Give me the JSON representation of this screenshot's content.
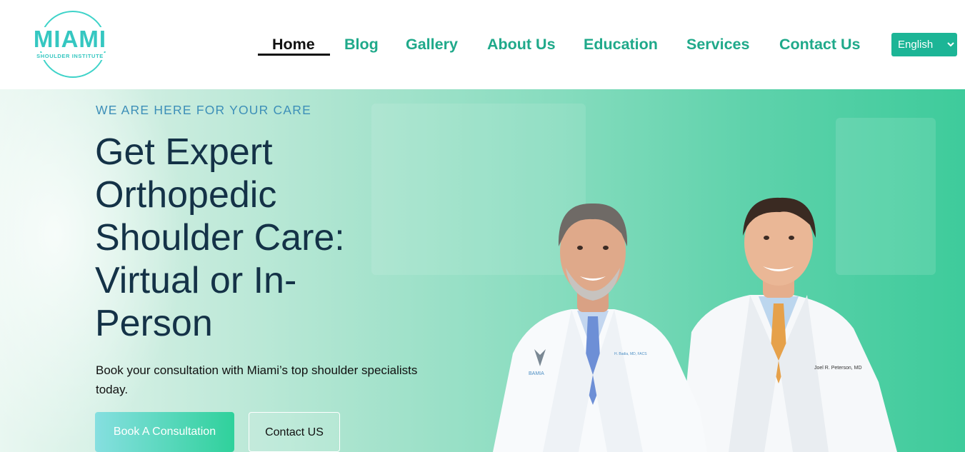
{
  "header": {
    "logo": {
      "word": "MIAMI",
      "sub": "SHOULDER INSTITUTE"
    },
    "nav": [
      {
        "label": "Home",
        "active": true
      },
      {
        "label": "Blog"
      },
      {
        "label": "Gallery"
      },
      {
        "label": "About Us"
      },
      {
        "label": "Education"
      },
      {
        "label": "Services"
      },
      {
        "label": "Contact Us"
      }
    ],
    "language": {
      "selected": "English",
      "icon": "chevron-down-icon"
    }
  },
  "hero": {
    "eyebrow": "WE ARE HERE FOR YOUR CARE",
    "headline": [
      "Get Expert",
      "Orthopedic",
      "Shoulder Care:",
      "Virtual or In-",
      "Person"
    ],
    "subtext": "Book your consultation with Miami’s top shoulder specialists today.",
    "primary_button": "Book A Consultation",
    "secondary_button": "Contact US",
    "photo": {
      "description_icon": "doctors-photo",
      "coat_left_badge": "BAMIA",
      "coat_left_name": "H. Badia, MD, FACS",
      "coat_right_name": "Joel R. Peterson, MD"
    }
  },
  "colors": {
    "accent": "#1fa98a",
    "logo": "#35c7c1",
    "headline": "#143247",
    "eyebrow": "#3d8fb8",
    "language_bg": "#1cb596"
  }
}
